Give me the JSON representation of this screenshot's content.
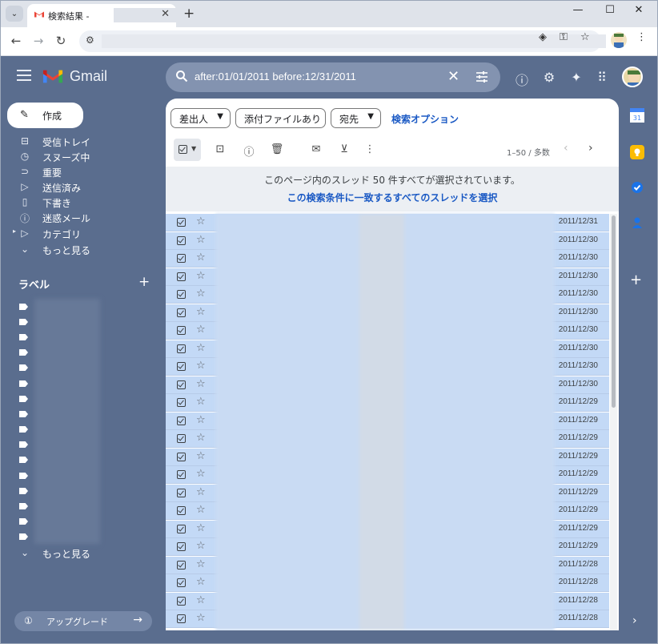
{
  "browser": {
    "tab_title": "検索結果 -",
    "new_tab": "+",
    "window_controls": {
      "minimize": "—",
      "maximize": "☐",
      "close": "✕"
    },
    "nav": {
      "back": "←",
      "forward": "→",
      "reload": "↻"
    }
  },
  "header": {
    "app_name": "Gmail",
    "search_query": "after:01/01/2011 before:12/31/2011",
    "icons": [
      "help-icon",
      "settings-icon",
      "gemini-icon",
      "apps-icon"
    ]
  },
  "sidebar": {
    "compose_label": "作成",
    "items": [
      {
        "label": "受信トレイ",
        "icon": "inbox-icon"
      },
      {
        "label": "スヌーズ中",
        "icon": "clock-icon"
      },
      {
        "label": "重要",
        "icon": "important-icon"
      },
      {
        "label": "送信済み",
        "icon": "send-icon"
      },
      {
        "label": "下書き",
        "icon": "draft-icon"
      },
      {
        "label": "迷惑メール",
        "icon": "spam-icon"
      },
      {
        "label": "カテゴリ",
        "icon": "category-icon"
      },
      {
        "label": "もっと見る",
        "icon": "chevron-down-icon"
      }
    ],
    "labels_heading": "ラベル",
    "labels_more": "もっと見る",
    "upgrade_label": "アップグレード"
  },
  "filters": {
    "from": "差出人",
    "has_attachment": "添付ファイルあり",
    "to": "宛先",
    "advanced": "検索オプション"
  },
  "pagination": {
    "text": "1–50 / 多数"
  },
  "banner": {
    "message": "このページ内のスレッド 50 件すべてが選択されています。",
    "select_all_link": "この検索条件に一致するすべてのスレッドを選択"
  },
  "threads": [
    {
      "date": "2011/12/31"
    },
    {
      "date": "2011/12/30"
    },
    {
      "date": "2011/12/30"
    },
    {
      "date": "2011/12/30"
    },
    {
      "date": "2011/12/30"
    },
    {
      "date": "2011/12/30"
    },
    {
      "date": "2011/12/30"
    },
    {
      "date": "2011/12/30"
    },
    {
      "date": "2011/12/30"
    },
    {
      "date": "2011/12/30"
    },
    {
      "date": "2011/12/29"
    },
    {
      "date": "2011/12/29"
    },
    {
      "date": "2011/12/29"
    },
    {
      "date": "2011/12/29"
    },
    {
      "date": "2011/12/29"
    },
    {
      "date": "2011/12/29"
    },
    {
      "date": "2011/12/29"
    },
    {
      "date": "2011/12/29"
    },
    {
      "date": "2011/12/29"
    },
    {
      "date": "2011/12/28"
    },
    {
      "date": "2011/12/28"
    },
    {
      "date": "2011/12/28"
    },
    {
      "date": "2011/12/28"
    }
  ],
  "colors": {
    "background": "#5a6d8e",
    "selected_row": "#c3d9f6",
    "link": "#1a59c4"
  }
}
